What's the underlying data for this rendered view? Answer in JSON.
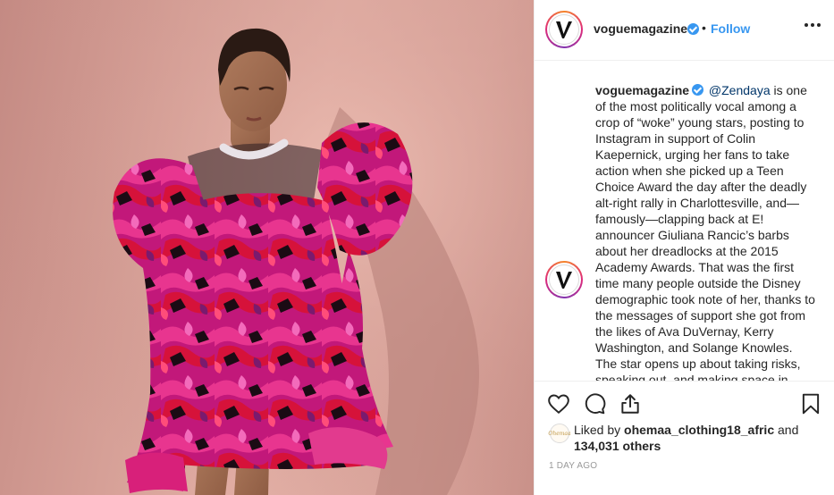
{
  "post": {
    "username": "voguemagazine",
    "dot": "•",
    "follow_label": "Follow",
    "caption": {
      "username": "voguemagazine",
      "mention": "@Zendaya",
      "text": " is one of the most politically vocal among a crop of “woke” young stars, posting to Instagram in support of Colin Kaepernick, urging her fans to take action when she picked up a Teen Choice Award the day after the deadly alt-right rally in Charlottesville, and—famously—clapping back at E! announcer Giuliana Rancic’s barbs about her dreadlocks at the 2015 Academy Awards. That was the first time many people outside the Disney demographic took note of her, thanks to the messages of support she got from the likes of Ava DuVernay, Kerry Washington, and Solange Knowles. The star opens up about taking risks, speaking out, and making space in"
    },
    "likes": {
      "prefix": "Liked by ",
      "liker": "ohemaa_clothing18_afric",
      "joiner": " and",
      "count": "134,031 others",
      "liker_avatar_text": "Ohemaa"
    },
    "timestamp": "1 DAY AGO",
    "avatar_letter": "V"
  },
  "icons": {
    "like": "heart-icon",
    "comment": "comment-icon",
    "share": "share-icon",
    "save": "bookmark-icon",
    "more": "more-options-icon",
    "verified": "verified-badge-icon"
  },
  "colors": {
    "link_blue": "#3897f0",
    "mention": "#003569",
    "text": "#262626",
    "muted": "#999999",
    "border": "#efefef"
  }
}
